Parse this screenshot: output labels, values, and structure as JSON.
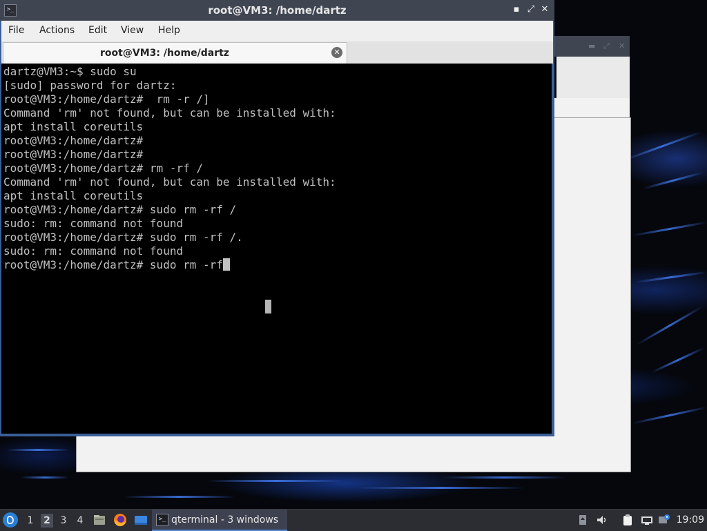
{
  "window": {
    "title": "root@VM3: /home/dartz",
    "app_icon_glyph": ">_",
    "minimize_glyph": "▪",
    "maximize_glyph": "⤢",
    "close_glyph": "✕"
  },
  "menubar": {
    "items": [
      "File",
      "Actions",
      "Edit",
      "View",
      "Help"
    ]
  },
  "tabs": [
    {
      "label": "root@VM3: /home/dartz",
      "close_glyph": "✕"
    }
  ],
  "terminal": {
    "lines": [
      "dartz@VM3:~$ sudo su",
      "[sudo] password for dartz:",
      "root@VM3:/home/dartz#  rm -r /]",
      "Command 'rm' not found, but can be installed with:",
      "apt install coreutils",
      "root@VM3:/home/dartz#",
      "root@VM3:/home/dartz#",
      "root@VM3:/home/dartz# rm -rf /",
      "Command 'rm' not found, but can be installed with:",
      "apt install coreutils",
      "root@VM3:/home/dartz# sudo rm -rf /",
      "sudo: rm: command not found",
      "root@VM3:/home/dartz# sudo rm -rf /.",
      "sudo: rm: command not found",
      "root@VM3:/home/dartz# sudo rm -rf"
    ],
    "background": "#000000",
    "foreground": "#c0c0c0"
  },
  "taskbar": {
    "workspaces": [
      "1",
      "2",
      "3",
      "4"
    ],
    "active_workspace": "2",
    "quicklaunch": [
      "file-manager-icon",
      "firefox-icon",
      "desktop-icon"
    ],
    "task": {
      "label": "qterminal - 3 windows",
      "icon": "terminal-icon",
      "icon_glyph": ">_"
    },
    "tray": [
      "usb-icon",
      "volume-icon",
      "clipboard-icon",
      "network-icon",
      "update-icon"
    ],
    "clock": "19:09"
  },
  "colors": {
    "titlebar": "#404552",
    "window_border": "#3a5f97",
    "taskbar": "#2b2d33",
    "accent": "#4f86d6"
  }
}
